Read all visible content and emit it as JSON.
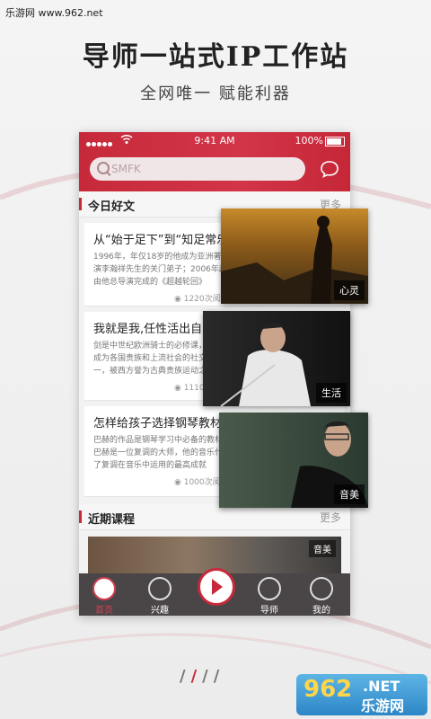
{
  "watermark": "乐游网 www.962.net",
  "headline": "导师一站式IP工作站",
  "subline": "全网唯一  赋能利器",
  "status": {
    "time": "9:41 AM",
    "battery": "100%"
  },
  "search": {
    "placeholder": "SMFK"
  },
  "section_today": {
    "title": "今日好文",
    "more": "更多"
  },
  "articles": [
    {
      "title": "从“始于足下”到“知足常乐”",
      "body": "1996年，年仅18岁的他成为亚洲著名华\n演李瀚祥先生的关门弟子；2006年起，\n由他总导演完成的《超越轮回》",
      "reads": "1220次阅读"
    },
    {
      "title": "我就是我,任性活出自己的",
      "body": "剑是中世纪欧洲骑士的必修课，\n成为各国贵族和上流社会的社交活\n一，被西方誉为古典贵族运动之首",
      "reads": "1110次阅读"
    },
    {
      "title": "怎样给孩子选择钢琴教材",
      "body": "巴赫的作品是钢琴学习中必备的教材。\n巴赫是一位复调的大师，他的音乐代表\n了复调在音乐中运用的最高成就",
      "reads": "1000次阅读"
    }
  ],
  "photos": [
    {
      "tag": "心灵"
    },
    {
      "tag": "生活"
    },
    {
      "tag": "音美"
    }
  ],
  "section_recent": {
    "title": "近期课程",
    "more": "更多"
  },
  "course": {
    "tag": "音美"
  },
  "tabs": {
    "home": "首页",
    "interest": "兴趣",
    "mentor": "导师",
    "mine": "我的"
  },
  "logo": {
    "brand": "962",
    "net": ".NET",
    "site": "乐游网"
  },
  "colors": {
    "accent": "#c62a3a",
    "tabbar": "#4a4546"
  }
}
